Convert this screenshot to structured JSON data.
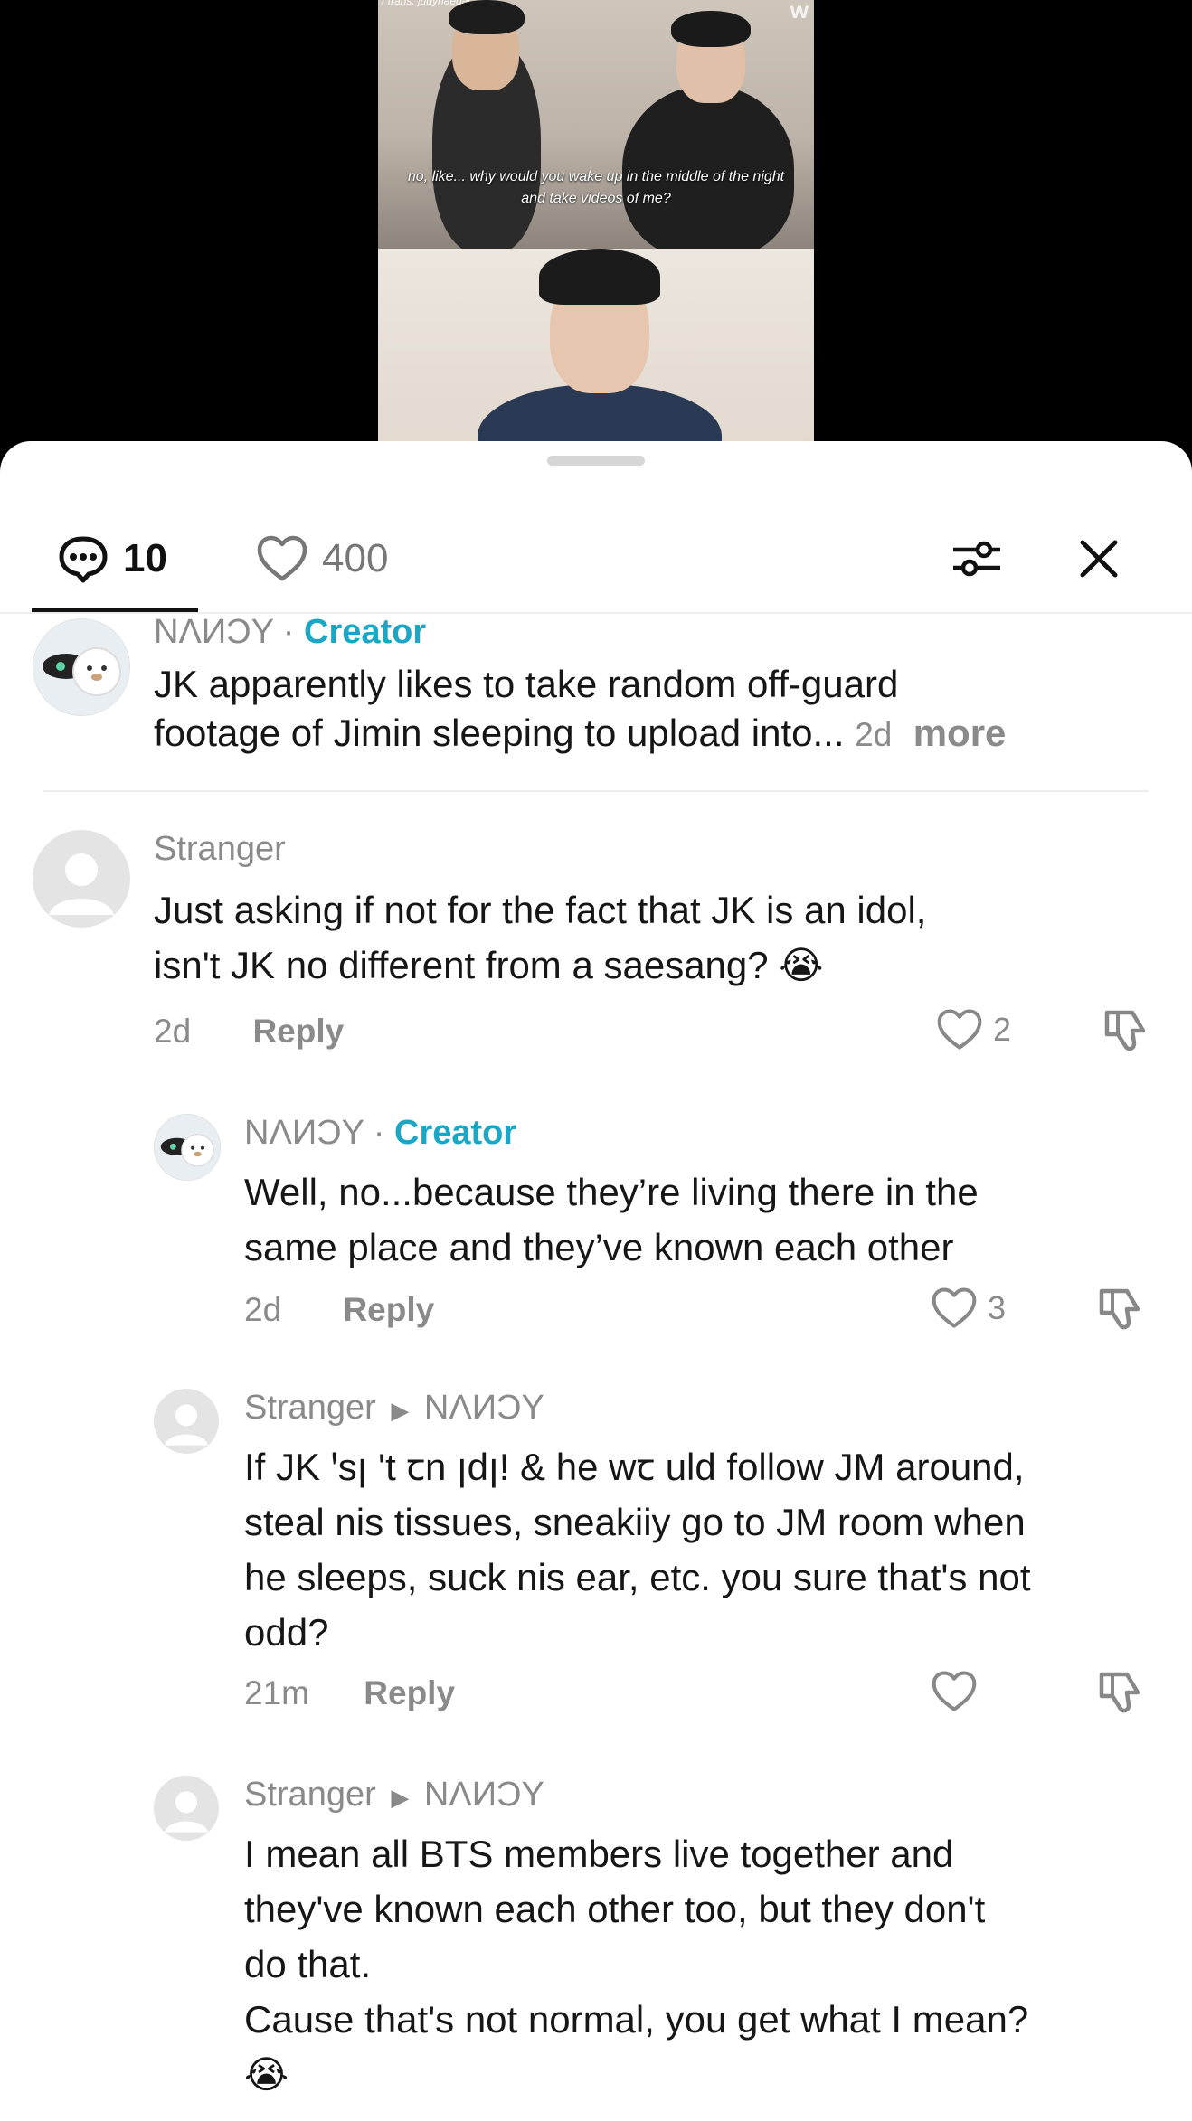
{
  "video": {
    "trans_credit": "/ trans: judyhaedal",
    "watermark": "w",
    "subtitle_line1": "no, like... why would you wake up in the middle of the night",
    "subtitle_line2": "and take videos of me?"
  },
  "header": {
    "comment_count": "10",
    "like_count": "400",
    "comment_icon": "chat-bubble-icon",
    "like_icon": "heart-outline-icon",
    "filter_icon": "sliders-icon",
    "close_icon": "close-x-icon"
  },
  "pinned": {
    "username": "NΛИϽY",
    "separator": " · ",
    "badge": "Creator",
    "text_line1": "JK apparently likes to take random off-guard",
    "text_line2": "footage of Jimin sleeping to upload into...",
    "age": "2d",
    "more": "more"
  },
  "comments": [
    {
      "username": "Stranger",
      "text_line1": "Just asking if not for the fact that JK is an idol,",
      "text_line2": "isn't JK no different from a saesang? 😭",
      "age": "2d",
      "reply": "Reply",
      "likes": "2"
    },
    {
      "username": "NΛИϽY",
      "separator": " · ",
      "badge": "Creator",
      "text_line1": "Well, no...because they’re living there in the",
      "text_line2": "same place and they’ve known each other",
      "age": "2d",
      "reply": "Reply",
      "likes": "3"
    },
    {
      "username": "Stranger",
      "reply_to": "NΛИϽY",
      "text_line1": "If JK ꞌsꞁ 't ꞇn ꞁdꞁ! & he wꞇ uld follow JM around,",
      "text_line2": "steal nis tissues, sneakiiy go to JM room when",
      "text_line3": "he sleeps, suck nis ear, etc. you sure that's not",
      "text_line4": "odd?",
      "age": "21m",
      "reply": "Reply",
      "likes": ""
    },
    {
      "username": "Stranger",
      "reply_to": "NΛИϽY",
      "text_line1": "I mean all BTS members live together and",
      "text_line2": "they've known each other too, but they don't",
      "text_line3": "do that.",
      "text_line4": "Cause that's not normal, you get what I mean?",
      "text_line5": "😭"
    }
  ]
}
